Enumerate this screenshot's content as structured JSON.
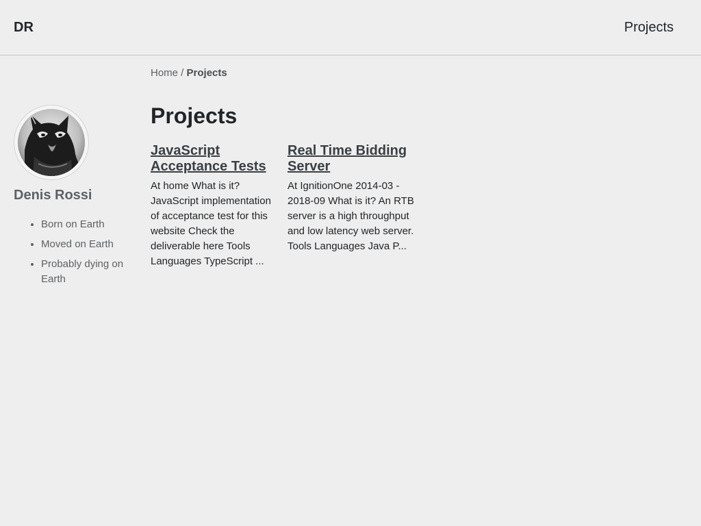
{
  "header": {
    "brand": "DR",
    "nav": [
      {
        "label": "Projects"
      }
    ]
  },
  "breadcrumb": {
    "home": "Home",
    "separator": " / ",
    "current": "Projects"
  },
  "sidebar": {
    "author_name": "Denis Rossi",
    "facts": [
      "Born on Earth",
      "Moved on Earth",
      "Probably dying on Earth"
    ]
  },
  "main": {
    "title": "Projects",
    "projects": [
      {
        "title": "JavaScript Acceptance Tests",
        "summary": "At home What is it? JavaScript implementation of acceptance test for this website Check the deliverable here Tools Languages TypeScript ..."
      },
      {
        "title": "Real Time Bidding Server",
        "summary": "At IgnitionOne 2014-03 - 2018-09 What is it? An RTB server is a high throughput and low latency web server. Tools Languages Java P..."
      }
    ]
  },
  "colors": {
    "background": "#eeeeee",
    "text": "#212529",
    "muted": "#5d6166"
  }
}
